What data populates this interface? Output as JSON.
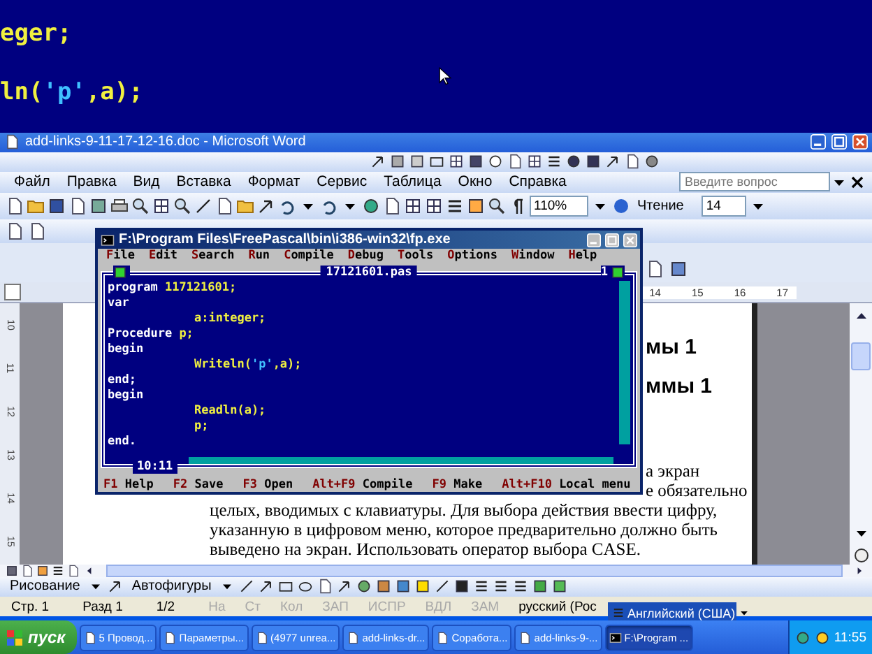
{
  "background_console": {
    "lines": [
      [
        {
          "text": "eger;",
          "kind": "ident"
        }
      ],
      [
        {
          "text": "ln(",
          "kind": "ident"
        },
        {
          "text": "'p'",
          "kind": "string"
        },
        {
          "text": ",a);",
          "kind": "ident"
        }
      ]
    ]
  },
  "word": {
    "title": "add-links-9-11-17-12-16.doc - Microsoft Word",
    "menu": [
      "Файл",
      "Правка",
      "Вид",
      "Вставка",
      "Формат",
      "Сервис",
      "Таблица",
      "Окно",
      "Справка"
    ],
    "help_search": {
      "placeholder": "Введите вопрос"
    },
    "zoom": "110%",
    "read_button": "Чтение",
    "font_size": "14",
    "ruler_labels": [
      "14",
      "15",
      "16",
      "17"
    ],
    "vertical_ruler_labels": [
      "10",
      "11",
      "12",
      "13",
      "14",
      "15"
    ],
    "document": {
      "partial_lines": [
        {
          "text": "мы 1",
          "kind": "heading"
        },
        {
          "text": "ммы 1",
          "kind": "heading"
        },
        {
          "text": "а экран",
          "kind": "body"
        },
        {
          "text": "е обязательно",
          "kind": "body"
        }
      ],
      "lines": [
        "целых, вводимых с клавиатуры. Для выбора действия ввести цифру,",
        "указанную в цифровом меню, которое предварительно должно быть",
        "выведено на экран. Использовать оператор выбора CASE."
      ]
    },
    "drawing_toolbar": {
      "draw_menu": "Рисование",
      "autoshapes_menu": "Автофигуры"
    },
    "status_bar": [
      {
        "text": "Стр. 1",
        "disabled": false
      },
      {
        "text": "Разд 1",
        "disabled": false
      },
      {
        "text": "1/2",
        "disabled": false
      },
      {
        "text": "На",
        "disabled": true
      },
      {
        "text": "Ст",
        "disabled": true
      },
      {
        "text": "Кол",
        "disabled": true
      },
      {
        "text": "ЗАП",
        "disabled": true
      },
      {
        "text": "ИСПР",
        "disabled": true
      },
      {
        "text": "ВДЛ",
        "disabled": true
      },
      {
        "text": "ЗАМ",
        "disabled": true
      },
      {
        "text": "русский (Рос",
        "disabled": false
      }
    ]
  },
  "console_window": {
    "title": "F:\\Program Files\\FreePascal\\bin\\i386-win32\\fp.exe",
    "menu": [
      "File",
      "Edit",
      "Search",
      "Run",
      "Compile",
      "Debug",
      "Tools",
      "Options",
      "Window",
      "Help"
    ],
    "file_name": "17121601.pas",
    "window_number": "1",
    "code": [
      {
        "kind": "top",
        "tokens": [
          {
            "text": "program ",
            "kind": "keyword"
          },
          {
            "text": "117121601;",
            "kind": "ident"
          }
        ]
      },
      {
        "kind": "top",
        "tokens": [
          {
            "text": "var",
            "kind": "keyword"
          }
        ]
      },
      {
        "kind": "nested",
        "tokens": [
          {
            "text": "a:integer;",
            "kind": "ident"
          }
        ]
      },
      {
        "kind": "top",
        "tokens": [
          {
            "text": "Procedure ",
            "kind": "keyword"
          },
          {
            "text": "p;",
            "kind": "ident"
          }
        ]
      },
      {
        "kind": "top",
        "tokens": [
          {
            "text": "begin",
            "kind": "keyword"
          }
        ]
      },
      {
        "kind": "nested",
        "tokens": [
          {
            "text": "Writeln(",
            "kind": "ident"
          },
          {
            "text": "'p'",
            "kind": "string"
          },
          {
            "text": ",a);",
            "kind": "ident"
          }
        ]
      },
      {
        "kind": "top",
        "tokens": [
          {
            "text": "end;",
            "kind": "keyword"
          }
        ]
      },
      {
        "kind": "top",
        "tokens": [
          {
            "text": "begin",
            "kind": "keyword"
          }
        ]
      },
      {
        "kind": "nested",
        "tokens": [
          {
            "text": "Readln(a);",
            "kind": "ident"
          }
        ]
      },
      {
        "kind": "nested",
        "tokens": [
          {
            "text": "p;",
            "kind": "ident"
          }
        ]
      },
      {
        "kind": "top",
        "tokens": [
          {
            "text": "end.",
            "kind": "keyword"
          }
        ]
      }
    ],
    "cursor_position": "10:11",
    "hotkeys": [
      {
        "key": "F1",
        "label": "Help"
      },
      {
        "key": "F2",
        "label": "Save"
      },
      {
        "key": "F3",
        "label": "Open"
      },
      {
        "key": "Alt+F9",
        "label": "Compile"
      },
      {
        "key": "F9",
        "label": "Make"
      },
      {
        "key": "Alt+F10",
        "label": "Local menu"
      }
    ]
  },
  "language_bar": {
    "label": "Английский (США)"
  },
  "taskbar": {
    "start": "пуск",
    "buttons": [
      {
        "label": "5 Провод...",
        "selected": false
      },
      {
        "label": "Параметры...",
        "selected": false
      },
      {
        "label": "(4977 unrea...",
        "selected": false
      },
      {
        "label": "add-links-dr...",
        "selected": false
      },
      {
        "label": "Соработа...",
        "selected": false
      },
      {
        "label": "add-links-9-...",
        "selected": false
      },
      {
        "label": "F:\\Program ...",
        "selected": true
      }
    ],
    "clock": "11:55"
  }
}
